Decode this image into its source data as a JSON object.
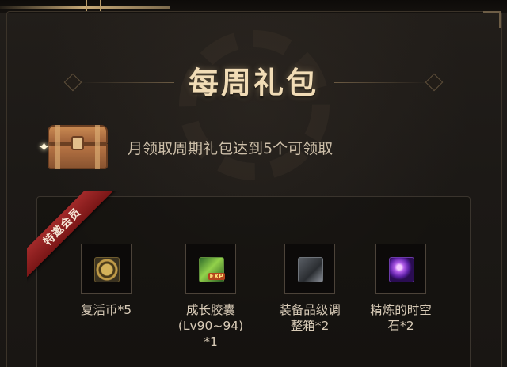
{
  "title": "每周礼包",
  "condition": "月领取周期礼包达到5个可领取",
  "badge": "特邀会员",
  "icons": {
    "chest": "treasure-chest-icon",
    "sparkle": "sparkle-icon"
  },
  "rewards": [
    {
      "icon": "revive-coin-icon",
      "line1": "复活币*5",
      "line2": "",
      "line3": ""
    },
    {
      "icon": "growth-capsule-icon",
      "line1": "成长胶囊",
      "line2": "(Lv90~94)",
      "line3": "*1",
      "icon_badge": "EXP"
    },
    {
      "icon": "equipment-box-icon",
      "line1": "装备品级调",
      "line2": "整箱*2",
      "line3": ""
    },
    {
      "icon": "refining-stone-icon",
      "line1": "精炼的时空",
      "line2": "石*2",
      "line3": ""
    }
  ],
  "colors": {
    "title": "#f1dcb6",
    "text": "#d8cbb7",
    "ribbon": "#a22a2a",
    "background": "#1a1714"
  }
}
